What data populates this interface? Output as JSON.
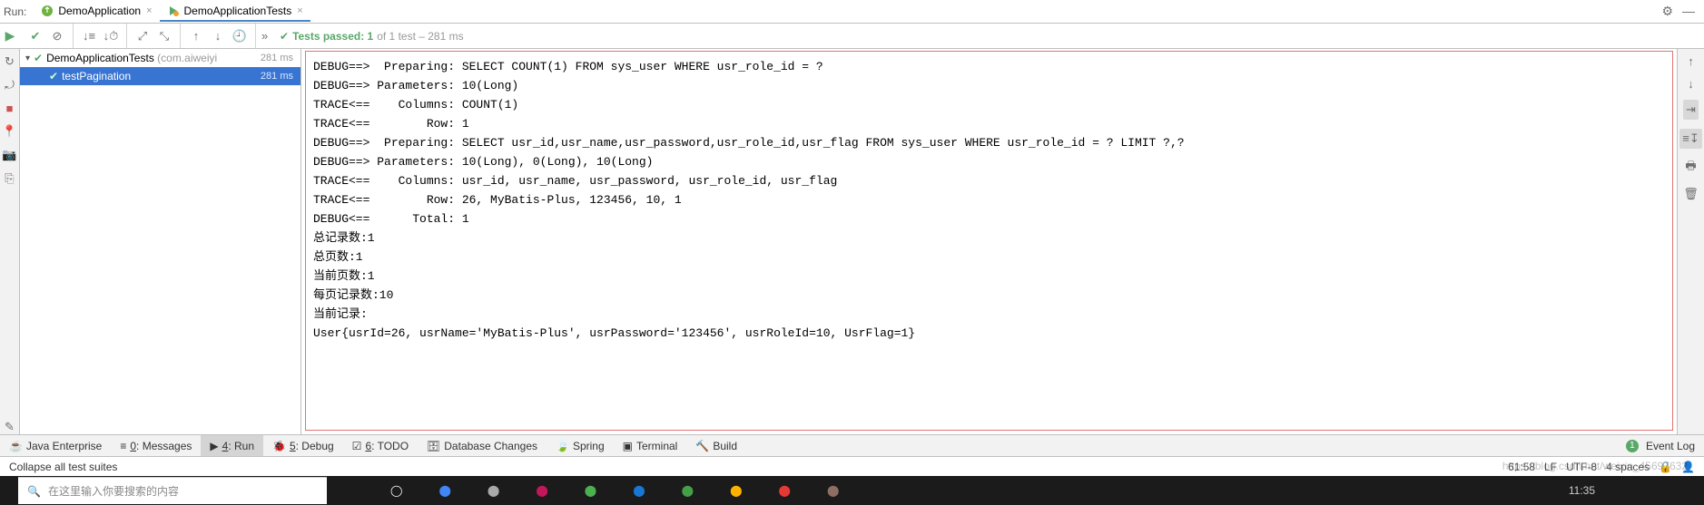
{
  "tabsRow": {
    "runLabel": "Run:",
    "tabs": [
      {
        "label": "DemoApplication",
        "active": false
      },
      {
        "label": "DemoApplicationTests",
        "active": true
      }
    ]
  },
  "testStatus": {
    "prefix": "Tests passed: 1",
    "suffix": " of 1 test – 281 ms"
  },
  "tree": {
    "root": {
      "label": "DemoApplicationTests",
      "package": "(com.aiweiyi",
      "time": "281 ms"
    },
    "child": {
      "label": "testPagination",
      "time": "281 ms"
    }
  },
  "consoleLines": [
    "DEBUG==>  Preparing: SELECT COUNT(1) FROM sys_user WHERE usr_role_id = ?",
    "DEBUG==> Parameters: 10(Long)",
    "TRACE<==    Columns: COUNT(1)",
    "TRACE<==        Row: 1",
    "DEBUG==>  Preparing: SELECT usr_id,usr_name,usr_password,usr_role_id,usr_flag FROM sys_user WHERE usr_role_id = ? LIMIT ?,?",
    "DEBUG==> Parameters: 10(Long), 0(Long), 10(Long)",
    "TRACE<==    Columns: usr_id, usr_name, usr_password, usr_role_id, usr_flag",
    "TRACE<==        Row: 26, MyBatis-Plus, 123456, 10, 1",
    "DEBUG<==      Total: 1",
    "总记录数:1",
    "总页数:1",
    "当前页数:1",
    "每页记录数:10",
    "当前记录:",
    "User{usrId=26, usrName='MyBatis-Plus', usrPassword='123456', usrRoleId=10, UsrFlag=1}"
  ],
  "bottomBar": {
    "items": [
      {
        "label": "Java Enterprise",
        "key": ""
      },
      {
        "label": "Messages",
        "key": "0"
      },
      {
        "label": "Run",
        "key": "4",
        "active": true
      },
      {
        "label": "Debug",
        "key": "5"
      },
      {
        "label": "TODO",
        "key": "6"
      },
      {
        "label": "Database Changes",
        "key": ""
      },
      {
        "label": "Spring",
        "key": ""
      },
      {
        "label": "Terminal",
        "key": ""
      },
      {
        "label": "Build",
        "key": ""
      }
    ],
    "eventLog": "Event Log",
    "eventCount": "1"
  },
  "statusBar": {
    "hint": "Collapse all test suites",
    "position": "61:58",
    "lf": "LF",
    "encoding": "UTF-8",
    "indent": "4 spaces"
  },
  "watermark": "https://blog.csdn.net/weixin_45697632",
  "taskbar": {
    "searchPlaceholder": "在这里输入你要搜索的内容",
    "time": "11:35"
  }
}
